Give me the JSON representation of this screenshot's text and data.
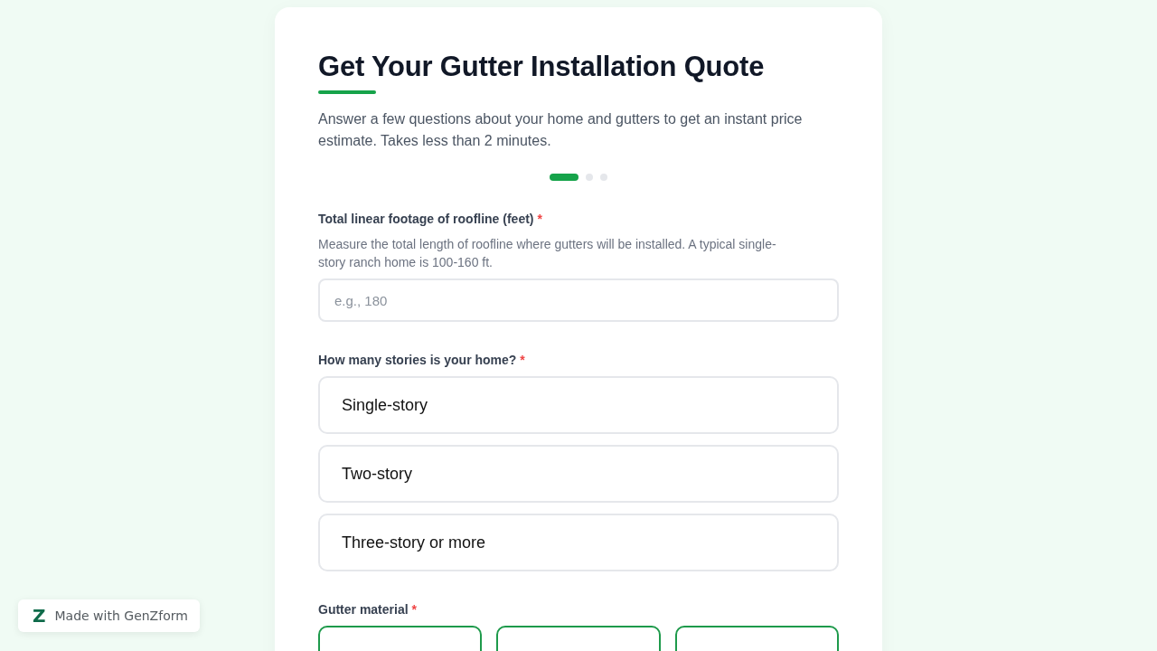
{
  "form": {
    "title": "Get Your Gutter Installation Quote",
    "description": "Answer a few questions about your home and gutters to get an instant price estimate. Takes less than 2 minutes.",
    "progress_steps": [
      {
        "selected": true
      },
      {
        "selected": false
      },
      {
        "selected": false
      }
    ],
    "fields": [
      {
        "kind": "number",
        "label": "Total linear footage of roofline (feet)",
        "required_mark": "*",
        "hint": "Measure the total length of roofline where gutters will be installed. A typical single-story ranch home is 100-160 ft.",
        "placeholder": "e.g., 180"
      },
      {
        "kind": "choice_list",
        "label": "How many stories is your home?",
        "required_mark": "*",
        "options": [
          {
            "label": "Single-story",
            "selected": false
          },
          {
            "label": "Two-story",
            "selected": false
          },
          {
            "label": "Three-story or more",
            "selected": false
          }
        ]
      },
      {
        "kind": "choice_grid",
        "label": "Gutter material",
        "required_mark": "*",
        "options": [
          {
            "selected": false
          },
          {
            "selected": false
          },
          {
            "selected": false
          }
        ]
      }
    ]
  },
  "badge": {
    "logo": "Z",
    "text": "Made with GenZform"
  }
}
